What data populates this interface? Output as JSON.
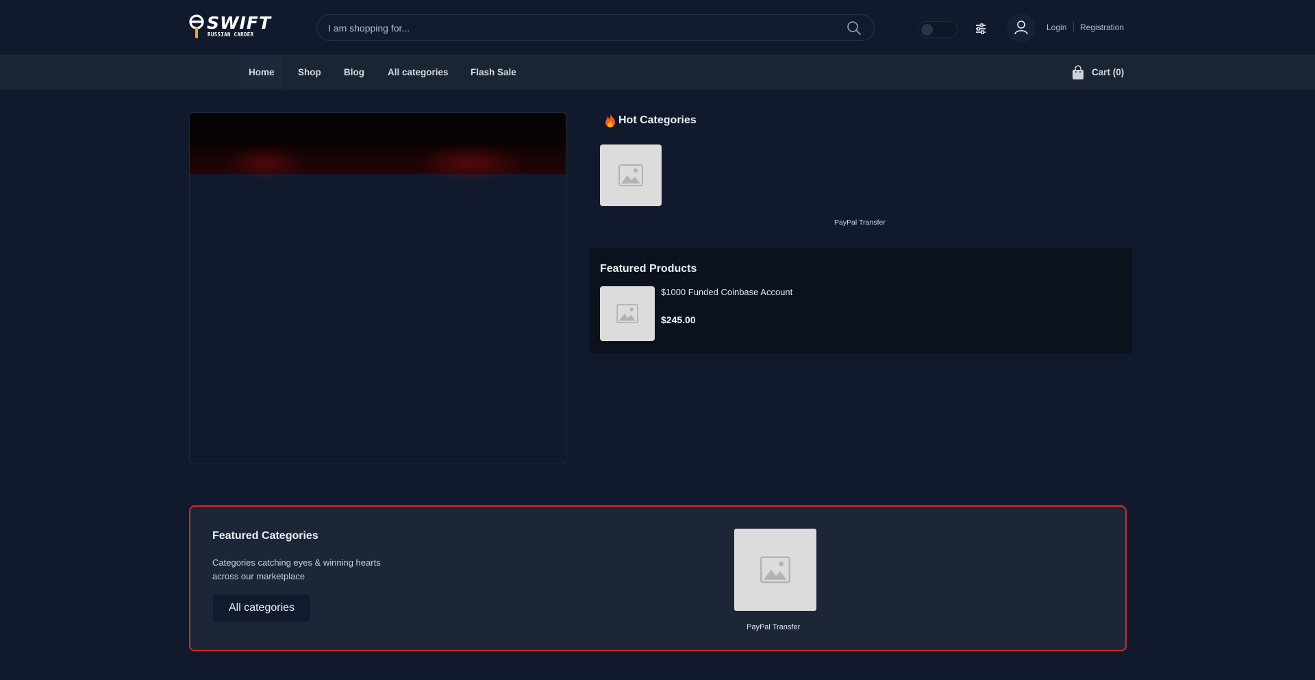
{
  "header": {
    "logo": {
      "word": "SWIFT",
      "tagline": "RUSSIAN CARDER"
    },
    "search": {
      "placeholder": "I am shopping for...",
      "value": ""
    },
    "theme_toggle": {
      "left_glyph": "",
      "right_glyph": ""
    },
    "login_label": "Login",
    "registration_label": "Registration"
  },
  "nav": {
    "menu_glyph": "",
    "links": [
      {
        "label": "Home"
      },
      {
        "label": "Shop"
      },
      {
        "label": "Blog"
      },
      {
        "label": "All categories"
      },
      {
        "label": "Flash Sale"
      }
    ],
    "cart_label": "Cart (0)"
  },
  "hot_categories": {
    "title": "Hot Categories",
    "items": [
      {
        "label": "PayPal Transfer"
      }
    ]
  },
  "featured_products": {
    "title": "Featured Products",
    "more_glyph": "",
    "items": [
      {
        "name": "$1000 Funded Coinbase Account",
        "price": "$245.00"
      }
    ]
  },
  "featured_categories": {
    "title": "Featured Categories",
    "description": "Categories catching eyes & winning hearts across our marketplace",
    "button_label": "All categories",
    "items": [
      {
        "label": "PayPal Transfer"
      }
    ]
  },
  "icons": [
    "search-icon",
    "theme-toggle-icon",
    "sliders-icon",
    "user-icon",
    "menu-icon",
    "cart-bag-icon",
    "flame-icon",
    "image-placeholder-icon",
    "more-icon"
  ],
  "colors": {
    "background": "#111a2c",
    "nav": "#1a2432",
    "accent_border": "#d3292f",
    "card": "#0c121d"
  }
}
